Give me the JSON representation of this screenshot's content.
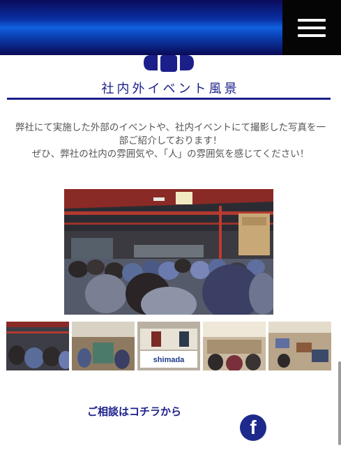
{
  "header": {
    "menu_icon": "hamburger-icon"
  },
  "section": {
    "title": "社内外イベント風景",
    "intro_line1": "弊社にて実施した外部のイベントや、社内イベントにて撮影した写真を一",
    "intro_line2": "部ご紹介しております！",
    "intro_line3": "ぜひ、弊社の社内の雰囲気や、「人」の雰囲気を感じてください！"
  },
  "gallery": {
    "main_photo": "event-photo-warehouse-crowd",
    "thumbnails": [
      "thumb-warehouse-crowd",
      "thumb-factory-event",
      "thumb-shimada-booth",
      "thumb-hall-meeting",
      "thumb-expo-booths"
    ],
    "booth_sign": "shimada"
  },
  "contact": {
    "label": "ご相談はコチラから",
    "facebook_icon": "facebook-icon"
  },
  "colors": {
    "brand_navy": "#1b1f8a",
    "header_blue": "#1061e0",
    "menu_black": "#050505"
  }
}
